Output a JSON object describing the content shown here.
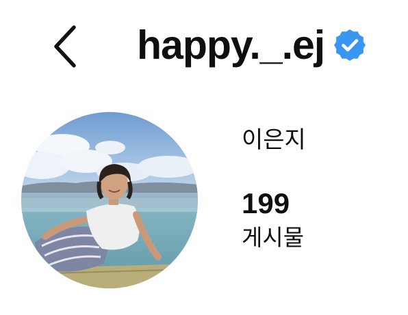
{
  "header": {
    "username": "happy._.ej",
    "back_icon": "chevron-left-icon",
    "verified_icon": "verified-badge-icon",
    "verified_color": "#3897f0"
  },
  "profile": {
    "display_name": "이은지",
    "avatar": "profile-photo",
    "stats": {
      "posts_count": "199",
      "posts_label": "게시물"
    }
  }
}
